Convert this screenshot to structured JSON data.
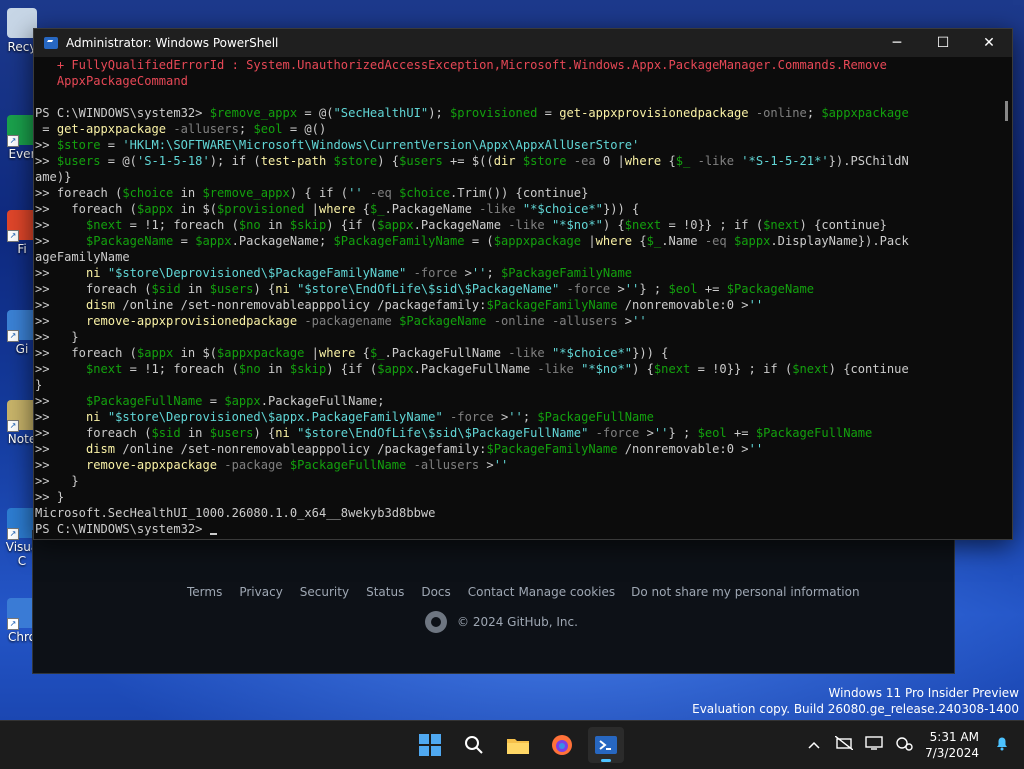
{
  "desktop": {
    "icons": [
      {
        "label": "Recy",
        "color": "#c7d6e6"
      },
      {
        "label": "Ever",
        "color": "#1aa14c"
      },
      {
        "label": "Fi",
        "color": "#e0462a"
      },
      {
        "label": "Gi",
        "color": "#3b82d6"
      },
      {
        "label": "Note",
        "color": "#c8b46a"
      },
      {
        "label": "Visua",
        "label2": "C",
        "color": "#2d7dd2"
      },
      {
        "label": "Chro",
        "color": "#3a7bd5"
      }
    ]
  },
  "browser_footer": {
    "links": [
      "Terms",
      "Privacy",
      "Security",
      "Status",
      "Docs",
      "Contact",
      "Manage cookies",
      "Do not share my personal information"
    ],
    "copyright": "© 2024 GitHub, Inc."
  },
  "powershell": {
    "title": "Administrator: Windows PowerShell",
    "controls": {
      "minimize": "─",
      "maximize": "☐",
      "close": "✕"
    },
    "lines": [
      [
        {
          "t": "   + FullyQualifiedErrorId : System.UnauthorizedAccessException,Microsoft.Windows.Appx.PackageManager.Commands.Remove",
          "c": "err"
        }
      ],
      [
        {
          "t": "   AppxPackageCommand",
          "c": "err"
        }
      ],
      [
        {
          "t": "",
          "c": "kw"
        }
      ],
      [
        {
          "t": "PS C:\\WINDOWS\\system32> ",
          "c": "kw"
        },
        {
          "t": "$remove_appx",
          "c": "vr"
        },
        {
          "t": " = @(",
          "c": "kw"
        },
        {
          "t": "\"SecHealthUI\"",
          "c": "st"
        },
        {
          "t": "); ",
          "c": "kw"
        },
        {
          "t": "$provisioned",
          "c": "vr"
        },
        {
          "t": " = ",
          "c": "kw"
        },
        {
          "t": "get-appxprovisionedpackage",
          "c": "cm"
        },
        {
          "t": " -online",
          "c": "pa"
        },
        {
          "t": "; ",
          "c": "kw"
        },
        {
          "t": "$appxpackage",
          "c": "vr"
        }
      ],
      [
        {
          "t": " = ",
          "c": "kw"
        },
        {
          "t": "get-appxpackage",
          "c": "cm"
        },
        {
          "t": " -allusers",
          "c": "pa"
        },
        {
          "t": "; ",
          "c": "kw"
        },
        {
          "t": "$eol",
          "c": "vr"
        },
        {
          "t": " = @()",
          "c": "kw"
        }
      ],
      [
        {
          "t": ">> ",
          "c": "kw"
        },
        {
          "t": "$store",
          "c": "vr"
        },
        {
          "t": " = ",
          "c": "kw"
        },
        {
          "t": "'HKLM:\\SOFTWARE\\Microsoft\\Windows\\CurrentVersion\\Appx\\AppxAllUserStore'",
          "c": "st"
        }
      ],
      [
        {
          "t": ">> ",
          "c": "kw"
        },
        {
          "t": "$users",
          "c": "vr"
        },
        {
          "t": " = @(",
          "c": "kw"
        },
        {
          "t": "'S-1-5-18'",
          "c": "st"
        },
        {
          "t": "); if (",
          "c": "kw"
        },
        {
          "t": "test-path",
          "c": "cm"
        },
        {
          "t": " ",
          "c": "kw"
        },
        {
          "t": "$store",
          "c": "vr"
        },
        {
          "t": ") {",
          "c": "kw"
        },
        {
          "t": "$users",
          "c": "vr"
        },
        {
          "t": " += $((",
          "c": "kw"
        },
        {
          "t": "dir",
          "c": "cm"
        },
        {
          "t": " ",
          "c": "kw"
        },
        {
          "t": "$store",
          "c": "vr"
        },
        {
          "t": " -ea",
          "c": "pa"
        },
        {
          "t": " 0 |",
          "c": "kw"
        },
        {
          "t": "where",
          "c": "cm"
        },
        {
          "t": " {",
          "c": "kw"
        },
        {
          "t": "$_",
          "c": "vr"
        },
        {
          "t": " -like",
          "c": "pa"
        },
        {
          "t": " ",
          "c": "kw"
        },
        {
          "t": "'*S-1-5-21*'",
          "c": "st"
        },
        {
          "t": "}).PSChildN",
          "c": "kw"
        }
      ],
      [
        {
          "t": "ame)}",
          "c": "kw"
        }
      ],
      [
        {
          "t": ">> ",
          "c": "kw"
        },
        {
          "t": "foreach",
          "c": "kw"
        },
        {
          "t": " (",
          "c": "kw"
        },
        {
          "t": "$choice",
          "c": "vr"
        },
        {
          "t": " in ",
          "c": "kw"
        },
        {
          "t": "$remove_appx",
          "c": "vr"
        },
        {
          "t": ") { if (",
          "c": "kw"
        },
        {
          "t": "''",
          "c": "st"
        },
        {
          "t": " -eq",
          "c": "pa"
        },
        {
          "t": " ",
          "c": "kw"
        },
        {
          "t": "$choice",
          "c": "vr"
        },
        {
          "t": ".Trim()) {continue}",
          "c": "kw"
        }
      ],
      [
        {
          "t": ">>   foreach (",
          "c": "kw"
        },
        {
          "t": "$appx",
          "c": "vr"
        },
        {
          "t": " in $(",
          "c": "kw"
        },
        {
          "t": "$provisioned",
          "c": "vr"
        },
        {
          "t": " |",
          "c": "kw"
        },
        {
          "t": "where",
          "c": "cm"
        },
        {
          "t": " {",
          "c": "kw"
        },
        {
          "t": "$_",
          "c": "vr"
        },
        {
          "t": ".PackageName ",
          "c": "kw"
        },
        {
          "t": "-like",
          "c": "pa"
        },
        {
          "t": " ",
          "c": "kw"
        },
        {
          "t": "\"*$choice*\"",
          "c": "st"
        },
        {
          "t": "})) {",
          "c": "kw"
        }
      ],
      [
        {
          "t": ">>     ",
          "c": "kw"
        },
        {
          "t": "$next",
          "c": "vr"
        },
        {
          "t": " = !1; foreach (",
          "c": "kw"
        },
        {
          "t": "$no",
          "c": "vr"
        },
        {
          "t": " in ",
          "c": "kw"
        },
        {
          "t": "$skip",
          "c": "vr"
        },
        {
          "t": ") {if (",
          "c": "kw"
        },
        {
          "t": "$appx",
          "c": "vr"
        },
        {
          "t": ".PackageName ",
          "c": "kw"
        },
        {
          "t": "-like",
          "c": "pa"
        },
        {
          "t": " ",
          "c": "kw"
        },
        {
          "t": "\"*$no*\"",
          "c": "st"
        },
        {
          "t": ") {",
          "c": "kw"
        },
        {
          "t": "$next",
          "c": "vr"
        },
        {
          "t": " = !0}} ; if (",
          "c": "kw"
        },
        {
          "t": "$next",
          "c": "vr"
        },
        {
          "t": ") {continue}",
          "c": "kw"
        }
      ],
      [
        {
          "t": ">>     ",
          "c": "kw"
        },
        {
          "t": "$PackageName",
          "c": "vr"
        },
        {
          "t": " = ",
          "c": "kw"
        },
        {
          "t": "$appx",
          "c": "vr"
        },
        {
          "t": ".PackageName; ",
          "c": "kw"
        },
        {
          "t": "$PackageFamilyName",
          "c": "vr"
        },
        {
          "t": " = (",
          "c": "kw"
        },
        {
          "t": "$appxpackage",
          "c": "vr"
        },
        {
          "t": " |",
          "c": "kw"
        },
        {
          "t": "where",
          "c": "cm"
        },
        {
          "t": " {",
          "c": "kw"
        },
        {
          "t": "$_",
          "c": "vr"
        },
        {
          "t": ".Name ",
          "c": "kw"
        },
        {
          "t": "-eq",
          "c": "pa"
        },
        {
          "t": " ",
          "c": "kw"
        },
        {
          "t": "$appx",
          "c": "vr"
        },
        {
          "t": ".DisplayName}).Pack",
          "c": "kw"
        }
      ],
      [
        {
          "t": "ageFamilyName",
          "c": "kw"
        }
      ],
      [
        {
          "t": ">>     ",
          "c": "kw"
        },
        {
          "t": "ni",
          "c": "cm"
        },
        {
          "t": " ",
          "c": "kw"
        },
        {
          "t": "\"$store\\Deprovisioned\\$PackageFamilyName\"",
          "c": "st"
        },
        {
          "t": " -force",
          "c": "pa"
        },
        {
          "t": " >",
          "c": "kw"
        },
        {
          "t": "''",
          "c": "st"
        },
        {
          "t": "; ",
          "c": "kw"
        },
        {
          "t": "$PackageFamilyName",
          "c": "vr"
        }
      ],
      [
        {
          "t": ">>     foreach (",
          "c": "kw"
        },
        {
          "t": "$sid",
          "c": "vr"
        },
        {
          "t": " in ",
          "c": "kw"
        },
        {
          "t": "$users",
          "c": "vr"
        },
        {
          "t": ") {",
          "c": "kw"
        },
        {
          "t": "ni",
          "c": "cm"
        },
        {
          "t": " ",
          "c": "kw"
        },
        {
          "t": "\"$store\\EndOfLife\\$sid\\$PackageName\"",
          "c": "st"
        },
        {
          "t": " -force",
          "c": "pa"
        },
        {
          "t": " >",
          "c": "kw"
        },
        {
          "t": "''",
          "c": "st"
        },
        {
          "t": "} ; ",
          "c": "kw"
        },
        {
          "t": "$eol",
          "c": "vr"
        },
        {
          "t": " += ",
          "c": "kw"
        },
        {
          "t": "$PackageName",
          "c": "vr"
        }
      ],
      [
        {
          "t": ">>     ",
          "c": "kw"
        },
        {
          "t": "dism",
          "c": "cm"
        },
        {
          "t": " /online /set-nonremovableapppolicy /packagefamily:",
          "c": "kw"
        },
        {
          "t": "$PackageFamilyName",
          "c": "vr"
        },
        {
          "t": " /nonremovable:0 >",
          "c": "kw"
        },
        {
          "t": "''",
          "c": "st"
        }
      ],
      [
        {
          "t": ">>     ",
          "c": "kw"
        },
        {
          "t": "remove-appxprovisionedpackage",
          "c": "cm"
        },
        {
          "t": " -packagename",
          "c": "pa"
        },
        {
          "t": " ",
          "c": "kw"
        },
        {
          "t": "$PackageName",
          "c": "vr"
        },
        {
          "t": " -online",
          "c": "pa"
        },
        {
          "t": " -allusers",
          "c": "pa"
        },
        {
          "t": " >",
          "c": "kw"
        },
        {
          "t": "''",
          "c": "st"
        }
      ],
      [
        {
          "t": ">>   }",
          "c": "kw"
        }
      ],
      [
        {
          "t": ">>   foreach (",
          "c": "kw"
        },
        {
          "t": "$appx",
          "c": "vr"
        },
        {
          "t": " in $(",
          "c": "kw"
        },
        {
          "t": "$appxpackage",
          "c": "vr"
        },
        {
          "t": " |",
          "c": "kw"
        },
        {
          "t": "where",
          "c": "cm"
        },
        {
          "t": " {",
          "c": "kw"
        },
        {
          "t": "$_",
          "c": "vr"
        },
        {
          "t": ".PackageFullName ",
          "c": "kw"
        },
        {
          "t": "-like",
          "c": "pa"
        },
        {
          "t": " ",
          "c": "kw"
        },
        {
          "t": "\"*$choice*\"",
          "c": "st"
        },
        {
          "t": "})) {",
          "c": "kw"
        }
      ],
      [
        {
          "t": ">>     ",
          "c": "kw"
        },
        {
          "t": "$next",
          "c": "vr"
        },
        {
          "t": " = !1; foreach (",
          "c": "kw"
        },
        {
          "t": "$no",
          "c": "vr"
        },
        {
          "t": " in ",
          "c": "kw"
        },
        {
          "t": "$skip",
          "c": "vr"
        },
        {
          "t": ") {if (",
          "c": "kw"
        },
        {
          "t": "$appx",
          "c": "vr"
        },
        {
          "t": ".PackageFullName ",
          "c": "kw"
        },
        {
          "t": "-like",
          "c": "pa"
        },
        {
          "t": " ",
          "c": "kw"
        },
        {
          "t": "\"*$no*\"",
          "c": "st"
        },
        {
          "t": ") {",
          "c": "kw"
        },
        {
          "t": "$next",
          "c": "vr"
        },
        {
          "t": " = !0}} ; if (",
          "c": "kw"
        },
        {
          "t": "$next",
          "c": "vr"
        },
        {
          "t": ") {continue",
          "c": "kw"
        }
      ],
      [
        {
          "t": "}",
          "c": "kw"
        }
      ],
      [
        {
          "t": ">>     ",
          "c": "kw"
        },
        {
          "t": "$PackageFullName",
          "c": "vr"
        },
        {
          "t": " = ",
          "c": "kw"
        },
        {
          "t": "$appx",
          "c": "vr"
        },
        {
          "t": ".PackageFullName;",
          "c": "kw"
        }
      ],
      [
        {
          "t": ">>     ",
          "c": "kw"
        },
        {
          "t": "ni",
          "c": "cm"
        },
        {
          "t": " ",
          "c": "kw"
        },
        {
          "t": "\"$store\\Deprovisioned\\$appx.PackageFamilyName\"",
          "c": "st"
        },
        {
          "t": " -force",
          "c": "pa"
        },
        {
          "t": " >",
          "c": "kw"
        },
        {
          "t": "''",
          "c": "st"
        },
        {
          "t": "; ",
          "c": "kw"
        },
        {
          "t": "$PackageFullName",
          "c": "vr"
        }
      ],
      [
        {
          "t": ">>     foreach (",
          "c": "kw"
        },
        {
          "t": "$sid",
          "c": "vr"
        },
        {
          "t": " in ",
          "c": "kw"
        },
        {
          "t": "$users",
          "c": "vr"
        },
        {
          "t": ") {",
          "c": "kw"
        },
        {
          "t": "ni",
          "c": "cm"
        },
        {
          "t": " ",
          "c": "kw"
        },
        {
          "t": "\"$store\\EndOfLife\\$sid\\$PackageFullName\"",
          "c": "st"
        },
        {
          "t": " -force",
          "c": "pa"
        },
        {
          "t": " >",
          "c": "kw"
        },
        {
          "t": "''",
          "c": "st"
        },
        {
          "t": "} ; ",
          "c": "kw"
        },
        {
          "t": "$eol",
          "c": "vr"
        },
        {
          "t": " += ",
          "c": "kw"
        },
        {
          "t": "$PackageFullName",
          "c": "vr"
        }
      ],
      [
        {
          "t": ">>     ",
          "c": "kw"
        },
        {
          "t": "dism",
          "c": "cm"
        },
        {
          "t": " /online /set-nonremovableapppolicy /packagefamily:",
          "c": "kw"
        },
        {
          "t": "$PackageFamilyName",
          "c": "vr"
        },
        {
          "t": " /nonremovable:0 >",
          "c": "kw"
        },
        {
          "t": "''",
          "c": "st"
        }
      ],
      [
        {
          "t": ">>     ",
          "c": "kw"
        },
        {
          "t": "remove-appxpackage",
          "c": "cm"
        },
        {
          "t": " -package",
          "c": "pa"
        },
        {
          "t": " ",
          "c": "kw"
        },
        {
          "t": "$PackageFullName",
          "c": "vr"
        },
        {
          "t": " -allusers",
          "c": "pa"
        },
        {
          "t": " >",
          "c": "kw"
        },
        {
          "t": "''",
          "c": "st"
        }
      ],
      [
        {
          "t": ">>   }",
          "c": "kw"
        }
      ],
      [
        {
          "t": ">> }",
          "c": "kw"
        }
      ],
      [
        {
          "t": "Microsoft.SecHealthUI_1000.26080.1.0_x64__8wekyb3d8bbwe",
          "c": "kw"
        }
      ],
      [
        {
          "t": "PS C:\\WINDOWS\\system32> ",
          "c": "kw"
        }
      ]
    ]
  },
  "watermark": {
    "line1": "Windows 11 Pro Insider Preview",
    "line2": "Evaluation copy. Build 26080.ge_release.240308-1400"
  },
  "taskbar": {
    "apps": [
      {
        "name": "start-button",
        "glyph": ""
      },
      {
        "name": "search-icon",
        "glyph": "⚲"
      },
      {
        "name": "file-explorer-icon",
        "glyph": ""
      },
      {
        "name": "firefox-icon",
        "glyph": ""
      },
      {
        "name": "powershell-taskbar-icon",
        "glyph": ""
      }
    ],
    "tray": {
      "chevron": "^",
      "network": "⚠",
      "display": "▭",
      "settings": "⚙",
      "notification": "🔔"
    },
    "time": "5:31 AM",
    "date": "7/3/2024"
  }
}
